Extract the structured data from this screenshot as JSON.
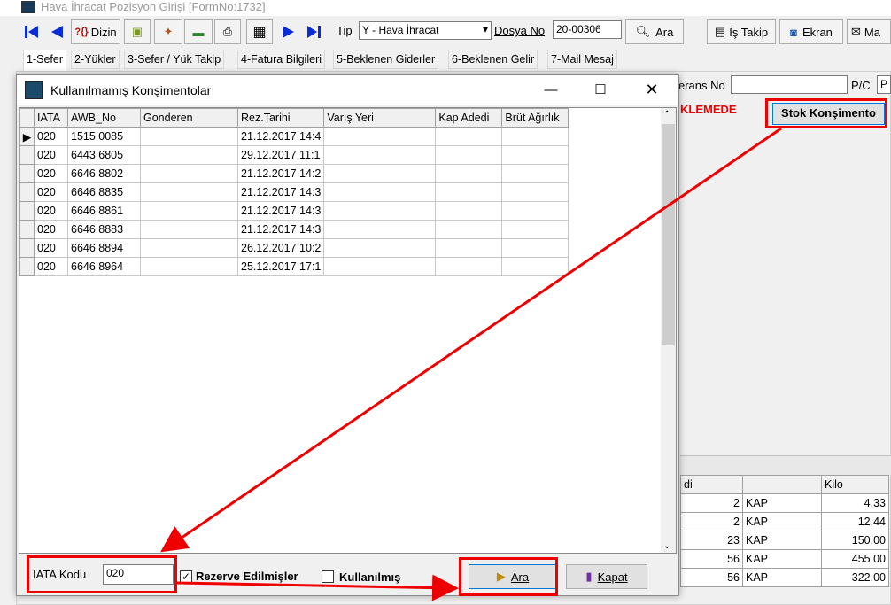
{
  "main": {
    "title": "Hava İhracat Pozisyon Girişi [FormNo:1732]",
    "toolbar": {
      "dizin_label": "Dizin",
      "dizin_prefix": "?{}",
      "tip_label": "Tip",
      "tip_value": "Y - Hava İhracat",
      "dosya_label": "Dosya No",
      "dosya_value": "20-00306",
      "ara_label": "Ara",
      "is_takip_label": "İş Takip",
      "ekran_label": "Ekran",
      "ma_label": "Ma"
    },
    "tabs": [
      "1-Sefer",
      "2-Yükler",
      "3-Sefer / Yük Takip",
      "4-Fatura Bilgileri",
      "5-Beklenen Giderler",
      "6-Beklenen Gelir",
      "7-Mail Mesaj"
    ],
    "referans_label": "erans No",
    "pc_label": "P/C",
    "pc_value": "P",
    "status_text": "KLEMEDE",
    "stok_button": "Stok Konşimento",
    "bg_grid": {
      "headers": [
        "di",
        "",
        "Kilo"
      ],
      "rows": [
        [
          "2",
          "KAP",
          "4,33"
        ],
        [
          "2",
          "KAP",
          "12,44"
        ],
        [
          "23",
          "KAP",
          "150,00"
        ],
        [
          "56",
          "KAP",
          "455,00"
        ],
        [
          "56",
          "KAP",
          "322,00"
        ]
      ]
    }
  },
  "dialog": {
    "title": "Kullanılmamış Konşimentolar",
    "columns": [
      "IATA",
      "AWB_No",
      "Gonderen",
      "Rez.Tarihi",
      "Varış Yeri",
      "Kap Adedi",
      "Brüt Ağırlık"
    ],
    "rows": [
      [
        "020",
        "1515 0085",
        "",
        "21.12.2017 14:4",
        "",
        "",
        ""
      ],
      [
        "020",
        "6443 6805",
        "",
        "29.12.2017 11:1",
        "",
        "",
        ""
      ],
      [
        "020",
        "6646 8802",
        "",
        "21.12.2017 14:2",
        "",
        "",
        ""
      ],
      [
        "020",
        "6646 8835",
        "",
        "21.12.2017 14:3",
        "",
        "",
        ""
      ],
      [
        "020",
        "6646 8861",
        "",
        "21.12.2017 14:3",
        "",
        "",
        ""
      ],
      [
        "020",
        "6646 8883",
        "",
        "21.12.2017 14:3",
        "",
        "",
        ""
      ],
      [
        "020",
        "6646 8894",
        "",
        "26.12.2017 10:2",
        "",
        "",
        ""
      ],
      [
        "020",
        "6646 8964",
        "",
        "25.12.2017 17:1",
        "",
        "",
        ""
      ]
    ],
    "iata_label": "IATA Kodu",
    "iata_value": "020",
    "rezerve_label": "Rezerve Edilmişler",
    "rezerve_checked": true,
    "kullanilmis_label": "Kullanılmış",
    "kullanilmis_checked": false,
    "ara_button": "Ara",
    "kapat_button": "Kapat"
  },
  "colors": {
    "annotation": "#e00000",
    "accent": "#0078d7",
    "status_red": "#e00000"
  }
}
